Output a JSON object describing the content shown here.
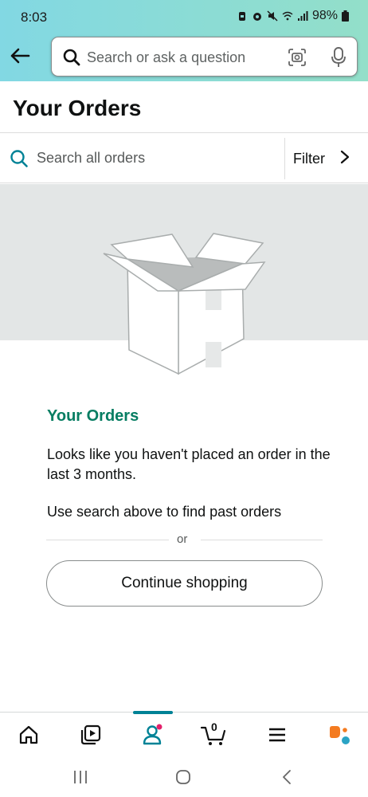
{
  "status_bar": {
    "time": "8:03",
    "battery": "98%"
  },
  "search": {
    "placeholder": "Search or ask a question"
  },
  "page": {
    "title": "Your Orders"
  },
  "orders_search": {
    "placeholder": "Search all orders",
    "filter_label": "Filter"
  },
  "empty_state": {
    "title": "Your Orders",
    "message": "Looks like you haven't placed an order in the last 3 months.",
    "hint": "Use search above to find past orders",
    "or": "or",
    "button_label": "Continue shopping"
  },
  "bottom_nav": {
    "items": [
      "home-icon",
      "video-icon",
      "account-icon",
      "cart-icon",
      "menu-icon",
      "rufus-icon"
    ],
    "active": "account-icon",
    "cart_count": "0"
  },
  "colors": {
    "accent": "#008296",
    "teal_title": "#067d62",
    "notification_dot": "#e3206b",
    "header_gradient_start": "#82d8e3",
    "header_gradient_end": "#93dfc9"
  }
}
